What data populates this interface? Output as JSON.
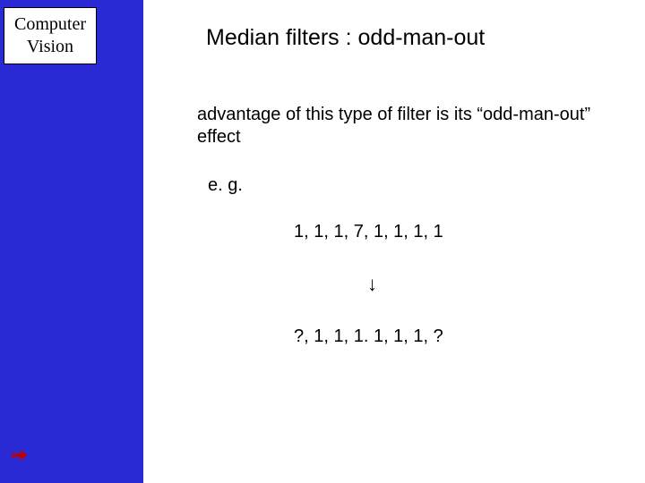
{
  "sidebar": {
    "title_line1": "Computer",
    "title_line2": "Vision",
    "arrow_icon": "arrow-right"
  },
  "slide": {
    "title": "Median filters  : odd-man-out",
    "body": "advantage of this type of filter is its “odd-man-out” effect",
    "eg_label": "e. g.",
    "sequence_before": "1, 1, 1, 7, 1, 1, 1, 1",
    "down_arrow": "↓",
    "sequence_after": "?, 1, 1, 1. 1, 1, 1, ?"
  }
}
